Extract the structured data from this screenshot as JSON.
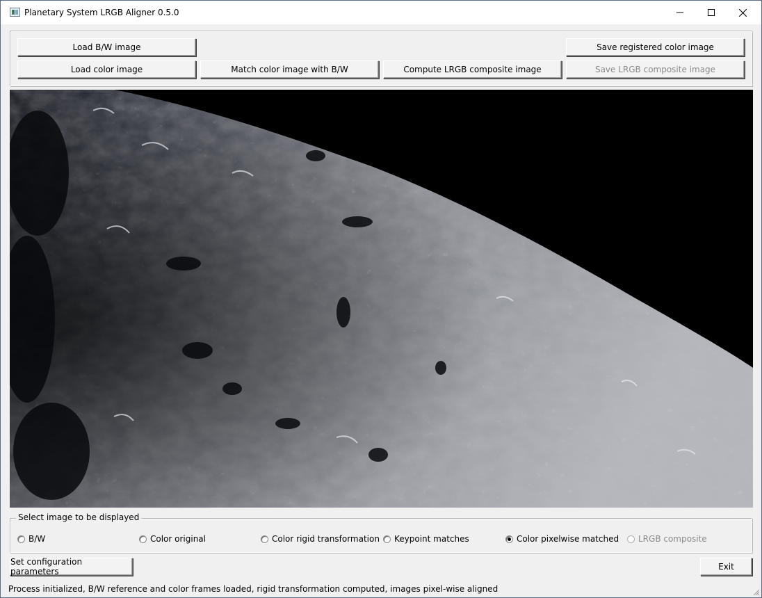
{
  "window": {
    "title": "Planetary System LRGB Aligner 0.5.0",
    "controls": [
      "minimize-icon",
      "maximize-icon",
      "close-icon"
    ]
  },
  "toolbar": {
    "load_bw": "Load B/W image",
    "load_color": "Load color image",
    "match_color": "Match color image with B/W",
    "compute_lrgb": "Compute LRGB composite image",
    "save_registered": "Save registered color image",
    "save_lrgb": "Save LRGB composite image",
    "save_lrgb_enabled": false
  },
  "display_select": {
    "legend": "Select image to be displayed",
    "options": [
      {
        "label": "B/W",
        "checked": false,
        "enabled": true
      },
      {
        "label": "Color original",
        "checked": false,
        "enabled": true
      },
      {
        "label": "Color rigid transformation",
        "checked": false,
        "enabled": true
      },
      {
        "label": "Keypoint matches",
        "checked": false,
        "enabled": true
      },
      {
        "label": "Color pixelwise matched",
        "checked": true,
        "enabled": true
      },
      {
        "label": "LRGB composite",
        "checked": false,
        "enabled": false
      }
    ]
  },
  "bottom": {
    "config_button": "Set configuration parameters",
    "exit_button": "Exit"
  },
  "status": {
    "message": "Process initialized, B/W reference and color frames loaded, rigid transformation computed, images pixel-wise aligned"
  },
  "colors": {
    "sky": "#000000",
    "lunar_surface": "#8a8c94",
    "disabled_text": "#8a8a8a"
  }
}
